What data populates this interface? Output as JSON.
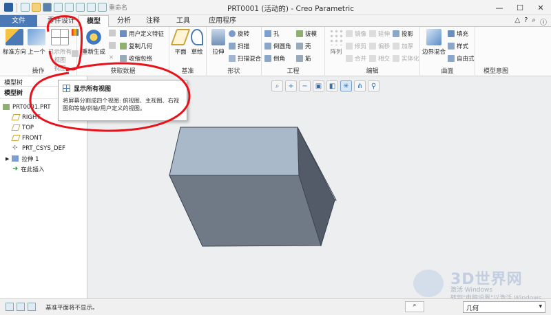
{
  "window": {
    "title": "PRT0001 (活动的) - Creo Parametric",
    "quick_access_label": "重命名"
  },
  "tabs": [
    "文件",
    "零件设计",
    "模型",
    "分析",
    "注释",
    "工具",
    "应用程序"
  ],
  "ribbon": {
    "groups": {
      "operations": "操作",
      "datum_tag": "获取数据",
      "datum": "基准",
      "shape": "形状",
      "engineering": "工程",
      "editing": "编辑",
      "surfaces": "曲面",
      "model_intent": "模型意图"
    },
    "buttons": {
      "std_orient": "标准方向",
      "prev": "上一个",
      "show_all_views": "显示所有视图",
      "views": "视图",
      "regenerate": "重新生成",
      "user_feature": "用户定义特征",
      "copy_geom": "复制几何",
      "shrinkwrap": "收缩包络",
      "plane": "平面",
      "sketch": "草绘",
      "extrude": "拉伸",
      "revolve": "旋转",
      "sweep": "扫描",
      "swept_blend": "扫描混合",
      "hole": "孔",
      "draft": "拔模",
      "round": "倒圆角",
      "shell": "壳",
      "chamfer": "倒角",
      "rib": "筋",
      "pattern": "阵列",
      "mirror": "镜像",
      "extend": "延伸",
      "project": "投影",
      "trim": "修剪",
      "offset": "偏移",
      "thicken": "加厚",
      "merge": "合并",
      "intersect": "相交",
      "solidify": "实体化",
      "boundary_blend": "边界混合",
      "fill": "填充",
      "style": "样式",
      "freestyle": "自由式"
    }
  },
  "model_tree": {
    "tab_label": "模型树",
    "toolbar_label": "模型树",
    "items": [
      "PRT0001.PRT",
      "RIGHT",
      "TOP",
      "FRONT",
      "PRT_CSYS_DEF",
      "拉伸 1",
      "在此插入"
    ]
  },
  "tooltip": {
    "title": "显示所有视图",
    "body": "将屏幕分割成四个视图: 俯视图、主视图、右视图和等轴/斜轴/用户定义的视图。"
  },
  "status": {
    "message": "基准平面将不显示。",
    "filter_value": "几何"
  },
  "watermark": {
    "line1": "3D世界网",
    "line2": "激活 Windows",
    "line3": "转到\"电脑设置\"以激活 Windows。"
  },
  "colors": {
    "file_tab": "#4a79b5",
    "cube_top": "#a9b9c9",
    "cube_front": "#6f7a86",
    "cube_side": "#525b67",
    "annotation_red": "#e8121a"
  }
}
